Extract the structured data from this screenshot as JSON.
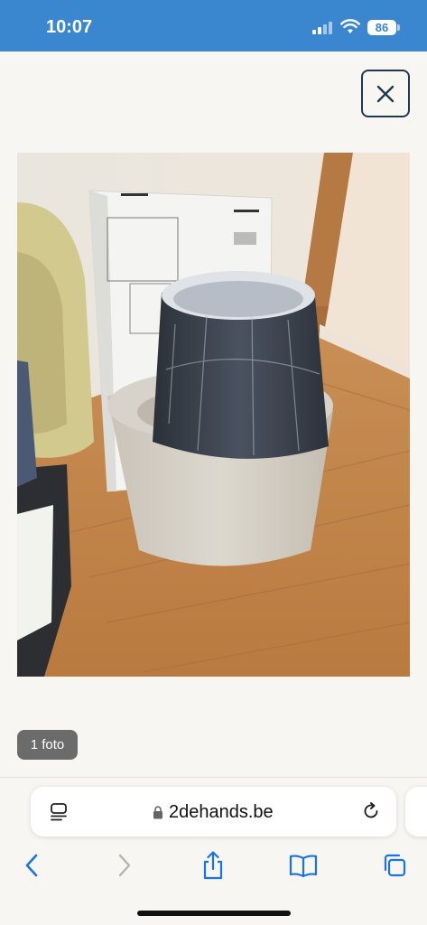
{
  "status_bar": {
    "time": "10:07",
    "battery": "86",
    "background_color": "#3a86cf"
  },
  "close_button": {
    "icon": "close-icon"
  },
  "photo": {
    "alt": "Grijze lampenkap en beige lampvoet op houten vloer"
  },
  "photo_count_badge": {
    "label": "1 foto"
  },
  "browser": {
    "url": "2dehands.be",
    "reader_icon": "page-menu-icon",
    "lock_icon": "lock-icon",
    "reload_icon": "reload-icon",
    "toolbar": [
      "back-icon",
      "forward-icon",
      "share-icon",
      "bookmarks-icon",
      "tabs-icon"
    ],
    "accent_color": "#1a73e8"
  }
}
